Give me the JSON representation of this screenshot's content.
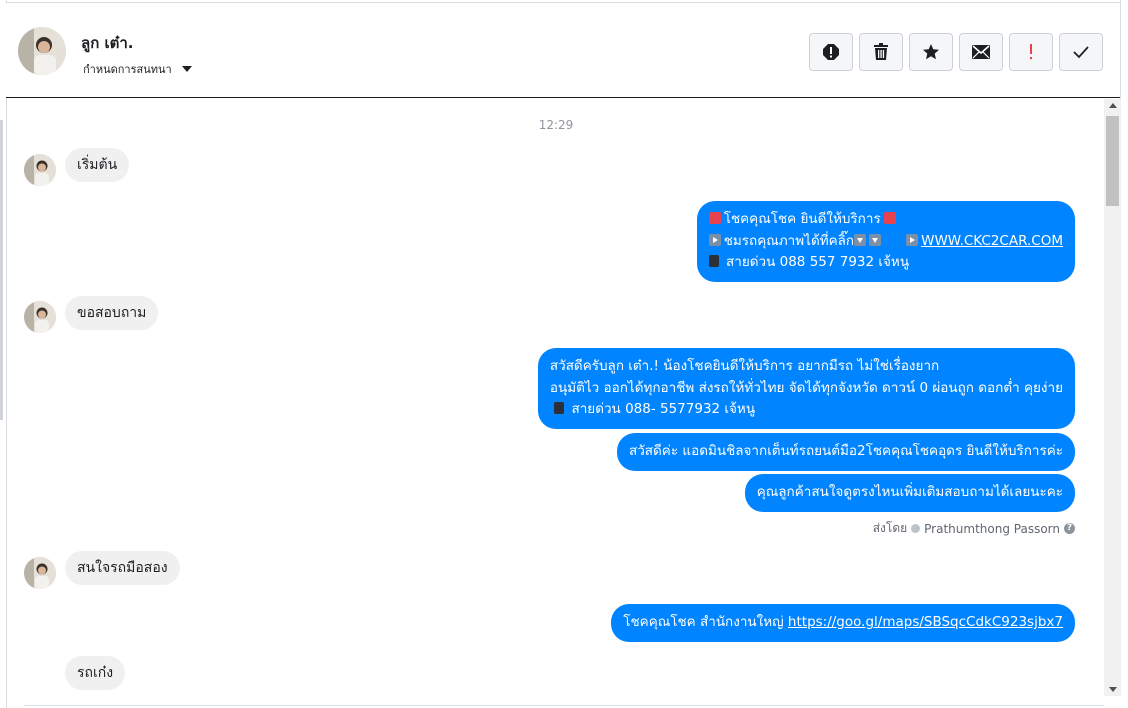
{
  "header": {
    "name": "ลูก เต๋า.",
    "manage_label": "กำหนดการสนทนา",
    "actions": [
      {
        "name": "spam-icon",
        "title": "spam"
      },
      {
        "name": "trash-icon",
        "title": "delete"
      },
      {
        "name": "star-icon",
        "title": "star"
      },
      {
        "name": "mail-icon",
        "title": "unread"
      },
      {
        "name": "exclamation-icon",
        "title": "important"
      },
      {
        "name": "checkmark-icon",
        "title": "done"
      }
    ]
  },
  "colors": {
    "outgoing_bubble": "#0084ff",
    "incoming_bubble": "#f1f0f0",
    "important_red": "#e8414f"
  },
  "chat": {
    "timestamp": "12:29",
    "m1": "เริ่มต้น",
    "m2": {
      "line1": "โชคคุณโชค ยินดีให้บริการ",
      "line2a": "ชมรถคุณภาพได้ที่คลิ๊ก",
      "line2b": "WWW.CKC2CAR.COM",
      "line3": "สายด่วน 088 557 7932 เจ้หนู"
    },
    "m3": "ขอสอบถาม",
    "m4": {
      "line1": "สวัสดีครับลูก เต๋า.! น้องโชคยินดีให้บริการ อยากมีรถ ไม่ใช่เรื่องยาก",
      "line2": "อนุมัติไว ออกได้ทุกอาชีพ ส่งรถให้ทั่วไทย จัดได้ทุกจังหวัด ดาวน์ 0  ผ่อนถูก ดอกต่ำ คุยง่าย",
      "line3": "สายด่วน 088- 5577932 เจ้หนู"
    },
    "m5": "สวัสดีค่ะ แอดมินชิลจากเต็นท์รถยนต์มือ2โชคคุณโชคอุดร ยินดีให้บริการค่ะ",
    "m6": "คุณลูกค้าสนใจดูตรงไหนเพิ่มเติมสอบถามได้เลยนะคะ",
    "sent_by_label": "ส่งโดย",
    "sent_by_name": "Prathumthong Passorn",
    "m7": "สนใจรถมือสอง",
    "m8": {
      "text": "โชคคุณโชค สำนักงานใหญ่",
      "link": "https://goo.gl/maps/SBSqcCdkC923sjbx7"
    },
    "m9": "รถเก๋ง"
  }
}
